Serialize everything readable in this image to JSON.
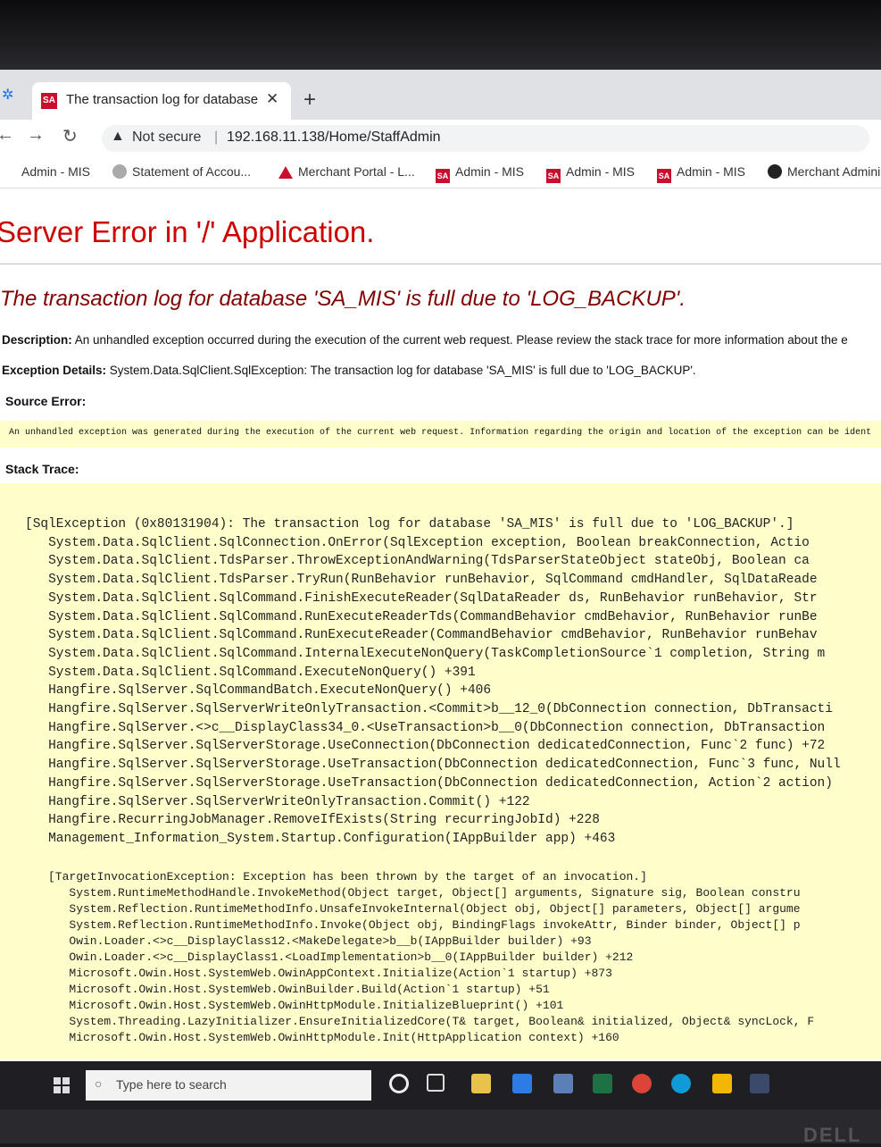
{
  "browser": {
    "tab_title": "The transaction log for database",
    "tab_favicon": "SA",
    "address_warning": "Not secure",
    "url": "192.168.11.138/Home/StaffAdmin",
    "bookmarks": [
      {
        "label": "Admin - MIS",
        "icon": "none"
      },
      {
        "label": "Statement of Accou...",
        "icon": "globe-icon"
      },
      {
        "label": "Merchant Portal - L...",
        "icon": "triangle-logo-icon"
      },
      {
        "label": "Admin - MIS",
        "icon": "sa-logo-icon"
      },
      {
        "label": "Admin - MIS",
        "icon": "sa-logo-icon"
      },
      {
        "label": "Admin - MIS",
        "icon": "sa-logo-icon"
      },
      {
        "label": "Merchant Admini",
        "icon": "dark-circle-icon"
      }
    ]
  },
  "page": {
    "heading": "Server Error in '/' Application.",
    "error_title": "The transaction log for database 'SA_MIS' is full due to 'LOG_BACKUP'.",
    "description_label": "Description:",
    "description_text": "An unhandled exception occurred during the execution of the current web request. Please review the stack trace for more information about the e",
    "exception_label": "Exception Details:",
    "exception_text": "System.Data.SqlClient.SqlException: The transaction log for database 'SA_MIS' is full due to 'LOG_BACKUP'.",
    "source_label": "Source Error:",
    "source_text": "An unhandled exception was generated during the execution of the current web request. Information regarding the origin and location of the exception can be ident",
    "stack_label": "Stack Trace:",
    "stack_block1": [
      "[SqlException (0x80131904): The transaction log for database 'SA_MIS' is full due to 'LOG_BACKUP'.]",
      "   System.Data.SqlClient.SqlConnection.OnError(SqlException exception, Boolean breakConnection, Actio",
      "   System.Data.SqlClient.TdsParser.ThrowExceptionAndWarning(TdsParserStateObject stateObj, Boolean ca",
      "   System.Data.SqlClient.TdsParser.TryRun(RunBehavior runBehavior, SqlCommand cmdHandler, SqlDataReade",
      "   System.Data.SqlClient.SqlCommand.FinishExecuteReader(SqlDataReader ds, RunBehavior runBehavior, Str",
      "   System.Data.SqlClient.SqlCommand.RunExecuteReaderTds(CommandBehavior cmdBehavior, RunBehavior runBe",
      "   System.Data.SqlClient.SqlCommand.RunExecuteReader(CommandBehavior cmdBehavior, RunBehavior runBehav",
      "   System.Data.SqlClient.SqlCommand.InternalExecuteNonQuery(TaskCompletionSource`1 completion, String m",
      "   System.Data.SqlClient.SqlCommand.ExecuteNonQuery() +391",
      "   Hangfire.SqlServer.SqlCommandBatch.ExecuteNonQuery() +406",
      "   Hangfire.SqlServer.SqlServerWriteOnlyTransaction.<Commit>b__12_0(DbConnection connection, DbTransacti",
      "   Hangfire.SqlServer.<>c__DisplayClass34_0.<UseTransaction>b__0(DbConnection connection, DbTransaction",
      "   Hangfire.SqlServer.SqlServerStorage.UseConnection(DbConnection dedicatedConnection, Func`2 func) +72",
      "   Hangfire.SqlServer.SqlServerStorage.UseTransaction(DbConnection dedicatedConnection, Func`3 func, Null",
      "   Hangfire.SqlServer.SqlServerStorage.UseTransaction(DbConnection dedicatedConnection, Action`2 action)",
      "   Hangfire.SqlServer.SqlServerWriteOnlyTransaction.Commit() +122",
      "   Hangfire.RecurringJobManager.RemoveIfExists(String recurringJobId) +228",
      "   Management_Information_System.Startup.Configuration(IAppBuilder app) +463"
    ],
    "stack_block2": [
      "[TargetInvocationException: Exception has been thrown by the target of an invocation.]",
      "   System.RuntimeMethodHandle.InvokeMethod(Object target, Object[] arguments, Signature sig, Boolean constru",
      "   System.Reflection.RuntimeMethodInfo.UnsafeInvokeInternal(Object obj, Object[] parameters, Object[] argume",
      "   System.Reflection.RuntimeMethodInfo.Invoke(Object obj, BindingFlags invokeAttr, Binder binder, Object[] p",
      "   Owin.Loader.<>c__DisplayClass12.<MakeDelegate>b__b(IAppBuilder builder) +93",
      "   Owin.Loader.<>c__DisplayClass1.<LoadImplementation>b__0(IAppBuilder builder) +212",
      "   Microsoft.Owin.Host.SystemWeb.OwinAppContext.Initialize(Action`1 startup) +873",
      "   Microsoft.Owin.Host.SystemWeb.OwinBuilder.Build(Action`1 startup) +51",
      "   Microsoft.Owin.Host.SystemWeb.OwinHttpModule.InitializeBlueprint() +101",
      "   System.Threading.LazyInitializer.EnsureInitializedCore(T& target, Boolean& initialized, Object& syncLock, F",
      "   Microsoft.Owin.Host.SystemWeb.OwinHttpModule.Init(HttpApplication context) +160"
    ]
  },
  "taskbar": {
    "search_placeholder": "Type here to search"
  },
  "monitor": {
    "brand": "DELL"
  },
  "colors": {
    "heading": "#cc0000",
    "error_title": "#800000",
    "code_bg": "#ffffcc"
  }
}
